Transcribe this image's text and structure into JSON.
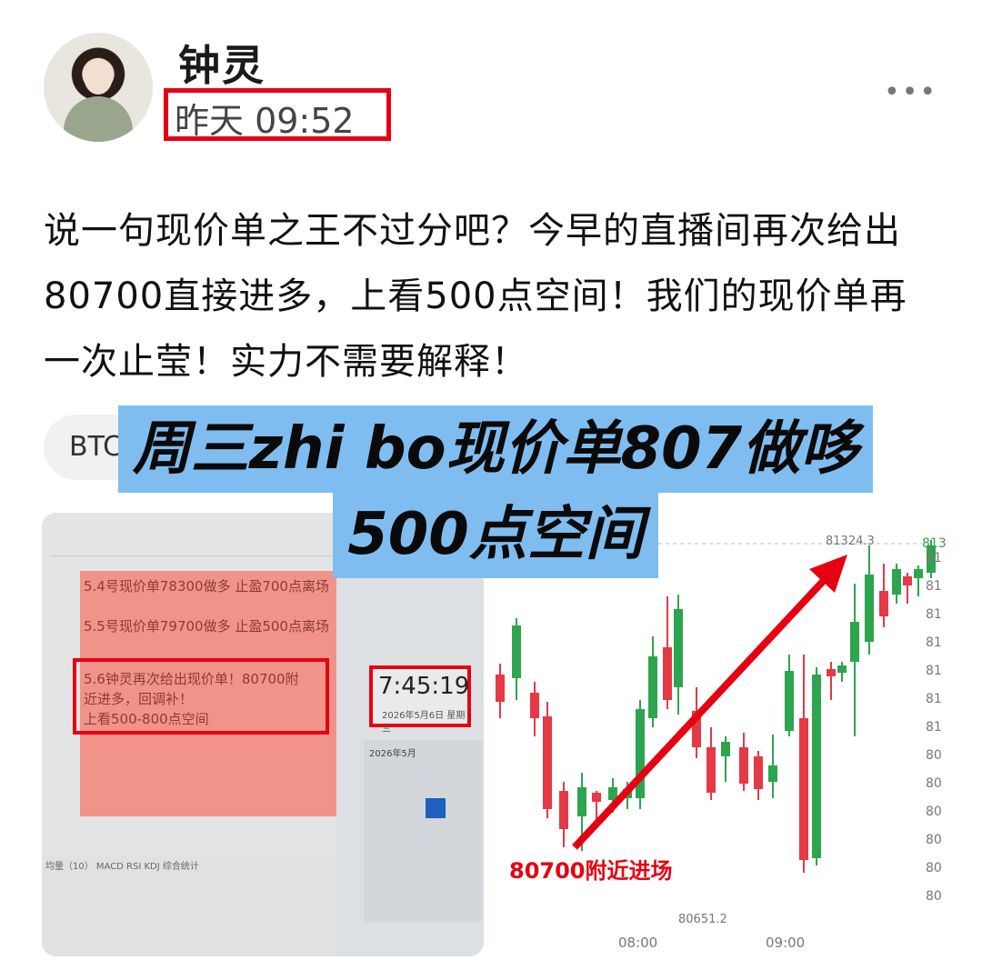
{
  "post": {
    "username": "钟灵",
    "time": "昨天 09:52",
    "more_icon": "•••",
    "text": "说一句现价单之王不过分吧？今早的直播间再次给出80700直接进多，上看500点空间！我们的现价单再一次止莹！实力不需要解释！",
    "tag": "BTC"
  },
  "image": {
    "banner_line1": "周三zhi bo现价单807做哆",
    "banner_line2": "500点空间",
    "photo": {
      "note1": "5.4号现价单78300做多    止盈700点离场",
      "note2": "5.5号现价单79700做多    止盈500点离场",
      "note3": "5.6钟灵再次给出现价单！80700附近进多，回调补！",
      "note4": "上看500-800点空间",
      "clock_time": "7:45:19",
      "clock_date": "2026年5月6日  星期三",
      "calendar_month": "2026年5月",
      "indicators": "均量（10）    MACD    RSI    KDJ    综合统计"
    },
    "chart": {
      "annotation": "80700附近进场",
      "high_label": "81324.3",
      "low_label": "80651.2",
      "x_labels": [
        "08:00",
        "09:00"
      ],
      "y_labels": [
        "813",
        "81",
        "81",
        "81",
        "81",
        "81",
        "81",
        "81",
        "80",
        "80",
        "80",
        "80",
        "80",
        "80"
      ],
      "up_color": "#2da44e",
      "down_color": "#e53945"
    }
  }
}
